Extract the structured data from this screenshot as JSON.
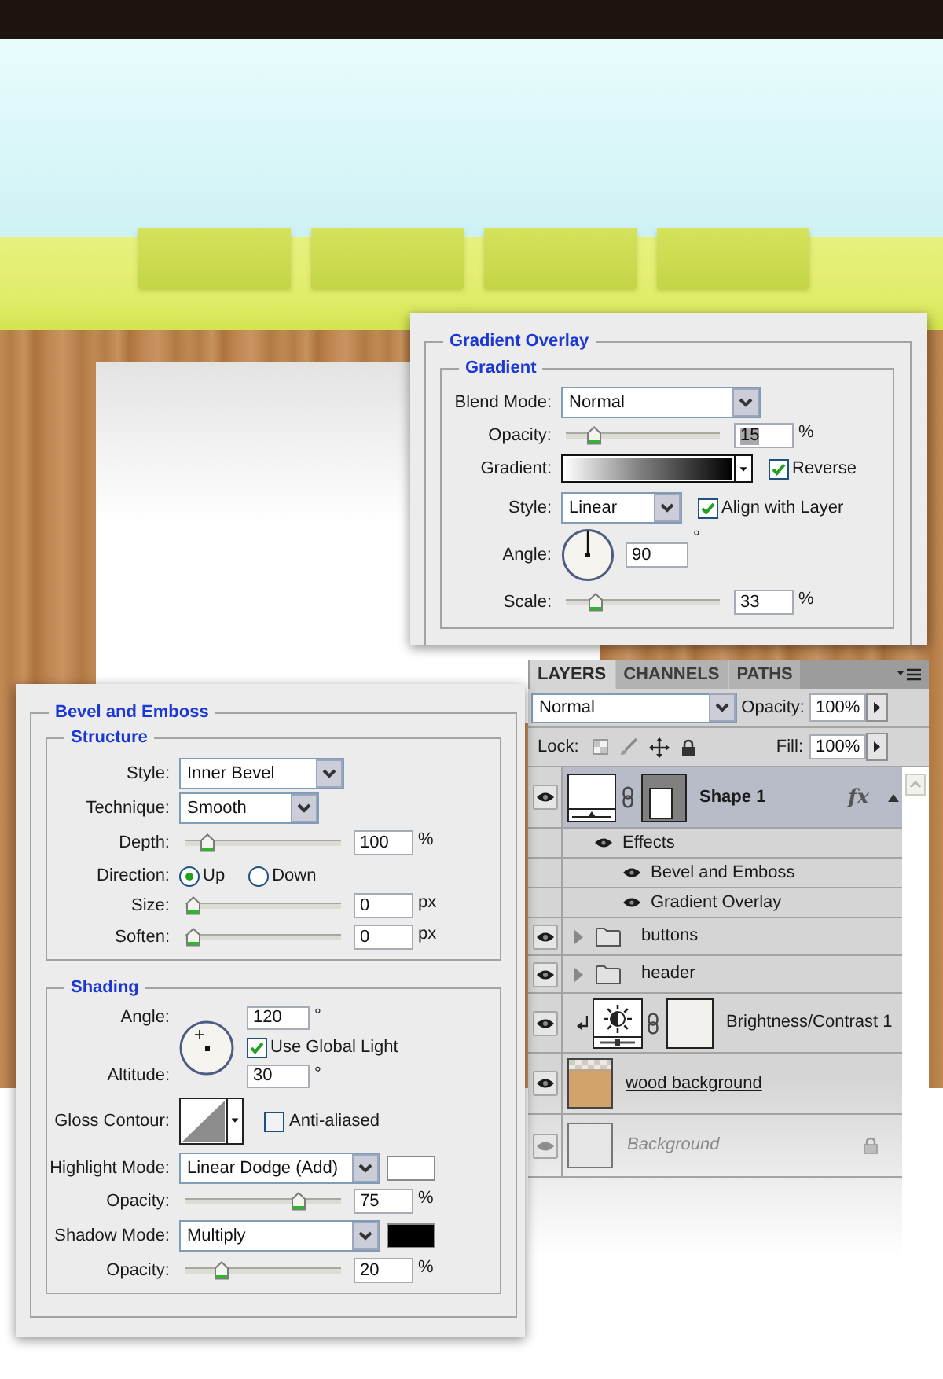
{
  "gradient_overlay": {
    "title": "Gradient Overlay",
    "section": "Gradient",
    "blend_mode": {
      "label": "Blend Mode:",
      "value": "Normal"
    },
    "opacity": {
      "label": "Opacity:",
      "level": 0.15,
      "value": "15",
      "highlighted": true,
      "unit": "%"
    },
    "gradient": {
      "label": "Gradient:"
    },
    "reverse": {
      "label": "Reverse",
      "checked": true
    },
    "style": {
      "label": "Style:",
      "value": "Linear"
    },
    "align_with_layer": {
      "label": "Align with Layer",
      "checked": true
    },
    "angle": {
      "label": "Angle:",
      "value": "90",
      "unit": "°"
    },
    "scale": {
      "label": "Scale:",
      "level": 0.16,
      "value": "33",
      "unit": "%"
    }
  },
  "bevel_and_emboss": {
    "title": "Bevel and Emboss",
    "structure": {
      "title": "Structure",
      "style": {
        "label": "Style:",
        "value": "Inner Bevel"
      },
      "technique": {
        "label": "Technique:",
        "value": "Smooth"
      },
      "depth": {
        "label": "Depth:",
        "level": 0.1,
        "value": "100",
        "unit": "%"
      },
      "direction": {
        "label": "Direction:",
        "options": [
          {
            "label": "Up",
            "selected": true
          },
          {
            "label": "Down",
            "selected": false
          }
        ]
      },
      "size": {
        "label": "Size:",
        "level": 0,
        "value": "0",
        "unit": "px"
      },
      "soften": {
        "label": "Soften:",
        "level": 0,
        "value": "0",
        "unit": "px"
      }
    },
    "shading": {
      "title": "Shading",
      "angle": {
        "label": "Angle:",
        "value": "120",
        "unit": "°"
      },
      "use_global_light": {
        "label": "Use Global Light",
        "checked": true
      },
      "altitude": {
        "label": "Altitude:",
        "value": "30",
        "unit": "°"
      },
      "gloss_contour": {
        "label": "Gloss Contour:"
      },
      "anti_aliased": {
        "label": "Anti-aliased",
        "checked": false
      },
      "highlight_mode": {
        "label": "Highlight Mode:",
        "value": "Linear Dodge (Add)",
        "color": "#ffffff"
      },
      "highlight_opacity": {
        "label": "Opacity:",
        "level": 0.75,
        "value": "75",
        "unit": "%"
      },
      "shadow_mode": {
        "label": "Shadow Mode:",
        "value": "Multiply",
        "color": "#000000"
      },
      "shadow_opacity": {
        "label": "Opacity:",
        "level": 0.2,
        "value": "20",
        "unit": "%"
      }
    }
  },
  "layers_panel": {
    "tabs": [
      {
        "label": "LAYERS",
        "selected": true
      },
      {
        "label": "CHANNELS",
        "selected": false
      },
      {
        "label": "PATHS",
        "selected": false
      }
    ],
    "blend_mode": {
      "value": "Normal"
    },
    "opacity": {
      "label": "Opacity:",
      "value": "100%"
    },
    "lock": {
      "label": "Lock:"
    },
    "fill": {
      "label": "Fill:",
      "value": "100%"
    },
    "layers": [
      {
        "kind": "shape",
        "name": "Shape 1",
        "visible": true,
        "selected": true,
        "locked": false,
        "clipped": false,
        "clipping_base": false,
        "fx": "fx",
        "expanded": true,
        "children": [
          {
            "name": "Effects",
            "visible": true,
            "children": [
              {
                "name": "Bevel and Emboss",
                "visible": true
              },
              {
                "name": "Gradient Overlay",
                "visible": true
              }
            ]
          }
        ]
      },
      {
        "kind": "group",
        "name": "buttons",
        "visible": true,
        "selected": false,
        "locked": false,
        "clipped": false,
        "clipping_base": false,
        "expanded": false
      },
      {
        "kind": "group",
        "name": "header",
        "visible": true,
        "selected": false,
        "locked": false,
        "clipped": false,
        "clipping_base": false,
        "expanded": false
      },
      {
        "kind": "adjustment",
        "name": "Brightness/Contrast 1",
        "visible": true,
        "selected": false,
        "locked": false,
        "clipped": true,
        "clipping_base": false
      },
      {
        "kind": "image",
        "name": "wood background",
        "visible": true,
        "selected": false,
        "locked": false,
        "clipped": false,
        "clipping_base": true
      },
      {
        "kind": "background",
        "name": "Background",
        "visible": true,
        "selected": false,
        "locked": true,
        "clipped": false,
        "clipping_base": false
      }
    ]
  }
}
